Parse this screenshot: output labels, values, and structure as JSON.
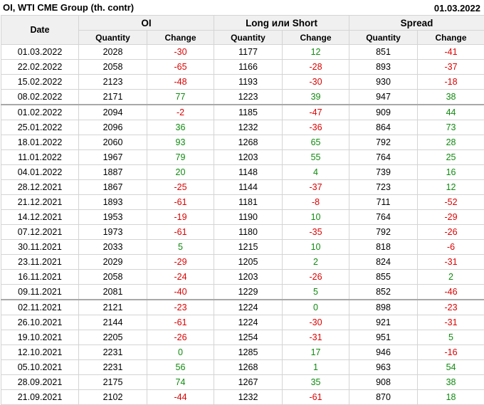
{
  "header": {
    "title": "OI, WTI CME Group (th. contr)",
    "date": "01.03.2022"
  },
  "columns": {
    "date": "Date",
    "groups": [
      "OI",
      "Long или Short",
      "Spread"
    ],
    "quantity": "Quantity",
    "change": "Change"
  },
  "colors": {
    "negative": "#dd0000",
    "positive": "#0f8a0f",
    "header_bg": "#f0f0f0"
  },
  "separator_after_rows": [
    3,
    16
  ],
  "rows": [
    {
      "date": "01.03.2022",
      "oi_q": "2028",
      "oi_c": "-30",
      "ls_q": "1177",
      "ls_c": "12",
      "sp_q": "851",
      "sp_c": "-41"
    },
    {
      "date": "22.02.2022",
      "oi_q": "2058",
      "oi_c": "-65",
      "ls_q": "1166",
      "ls_c": "-28",
      "sp_q": "893",
      "sp_c": "-37"
    },
    {
      "date": "15.02.2022",
      "oi_q": "2123",
      "oi_c": "-48",
      "ls_q": "1193",
      "ls_c": "-30",
      "sp_q": "930",
      "sp_c": "-18"
    },
    {
      "date": "08.02.2022",
      "oi_q": "2171",
      "oi_c": "77",
      "ls_q": "1223",
      "ls_c": "39",
      "sp_q": "947",
      "sp_c": "38"
    },
    {
      "date": "01.02.2022",
      "oi_q": "2094",
      "oi_c": "-2",
      "ls_q": "1185",
      "ls_c": "-47",
      "sp_q": "909",
      "sp_c": "44"
    },
    {
      "date": "25.01.2022",
      "oi_q": "2096",
      "oi_c": "36",
      "ls_q": "1232",
      "ls_c": "-36",
      "sp_q": "864",
      "sp_c": "73"
    },
    {
      "date": "18.01.2022",
      "oi_q": "2060",
      "oi_c": "93",
      "ls_q": "1268",
      "ls_c": "65",
      "sp_q": "792",
      "sp_c": "28"
    },
    {
      "date": "11.01.2022",
      "oi_q": "1967",
      "oi_c": "79",
      "ls_q": "1203",
      "ls_c": "55",
      "sp_q": "764",
      "sp_c": "25"
    },
    {
      "date": "04.01.2022",
      "oi_q": "1887",
      "oi_c": "20",
      "ls_q": "1148",
      "ls_c": "4",
      "sp_q": "739",
      "sp_c": "16"
    },
    {
      "date": "28.12.2021",
      "oi_q": "1867",
      "oi_c": "-25",
      "ls_q": "1144",
      "ls_c": "-37",
      "sp_q": "723",
      "sp_c": "12"
    },
    {
      "date": "21.12.2021",
      "oi_q": "1893",
      "oi_c": "-61",
      "ls_q": "1181",
      "ls_c": "-8",
      "sp_q": "711",
      "sp_c": "-52"
    },
    {
      "date": "14.12.2021",
      "oi_q": "1953",
      "oi_c": "-19",
      "ls_q": "1190",
      "ls_c": "10",
      "sp_q": "764",
      "sp_c": "-29"
    },
    {
      "date": "07.12.2021",
      "oi_q": "1973",
      "oi_c": "-61",
      "ls_q": "1180",
      "ls_c": "-35",
      "sp_q": "792",
      "sp_c": "-26"
    },
    {
      "date": "30.11.2021",
      "oi_q": "2033",
      "oi_c": "5",
      "ls_q": "1215",
      "ls_c": "10",
      "sp_q": "818",
      "sp_c": "-6"
    },
    {
      "date": "23.11.2021",
      "oi_q": "2029",
      "oi_c": "-29",
      "ls_q": "1205",
      "ls_c": "2",
      "sp_q": "824",
      "sp_c": "-31"
    },
    {
      "date": "16.11.2021",
      "oi_q": "2058",
      "oi_c": "-24",
      "ls_q": "1203",
      "ls_c": "-26",
      "sp_q": "855",
      "sp_c": "2"
    },
    {
      "date": "09.11.2021",
      "oi_q": "2081",
      "oi_c": "-40",
      "ls_q": "1229",
      "ls_c": "5",
      "sp_q": "852",
      "sp_c": "-46"
    },
    {
      "date": "02.11.2021",
      "oi_q": "2121",
      "oi_c": "-23",
      "ls_q": "1224",
      "ls_c": "0",
      "sp_q": "898",
      "sp_c": "-23"
    },
    {
      "date": "26.10.2021",
      "oi_q": "2144",
      "oi_c": "-61",
      "ls_q": "1224",
      "ls_c": "-30",
      "sp_q": "921",
      "sp_c": "-31"
    },
    {
      "date": "19.10.2021",
      "oi_q": "2205",
      "oi_c": "-26",
      "ls_q": "1254",
      "ls_c": "-31",
      "sp_q": "951",
      "sp_c": "5"
    },
    {
      "date": "12.10.2021",
      "oi_q": "2231",
      "oi_c": "0",
      "ls_q": "1285",
      "ls_c": "17",
      "sp_q": "946",
      "sp_c": "-16"
    },
    {
      "date": "05.10.2021",
      "oi_q": "2231",
      "oi_c": "56",
      "ls_q": "1268",
      "ls_c": "1",
      "sp_q": "963",
      "sp_c": "54"
    },
    {
      "date": "28.09.2021",
      "oi_q": "2175",
      "oi_c": "74",
      "ls_q": "1267",
      "ls_c": "35",
      "sp_q": "908",
      "sp_c": "38"
    },
    {
      "date": "21.09.2021",
      "oi_q": "2102",
      "oi_c": "-44",
      "ls_q": "1232",
      "ls_c": "-61",
      "sp_q": "870",
      "sp_c": "18"
    }
  ]
}
